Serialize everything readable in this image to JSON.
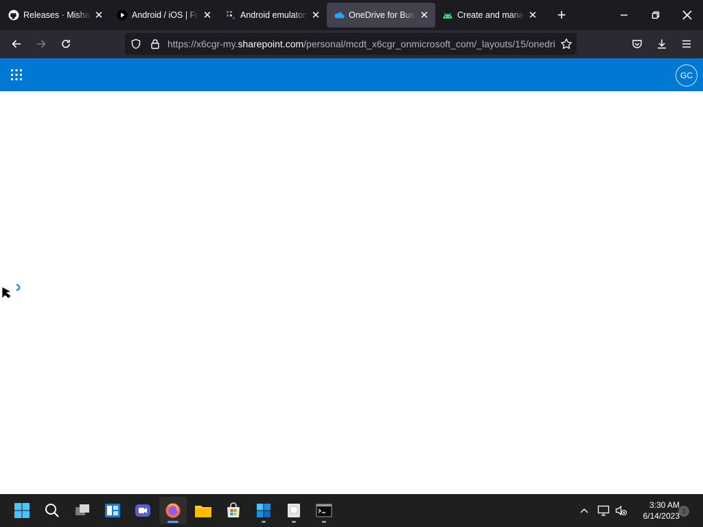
{
  "browser": {
    "tabs": [
      {
        "title": "Releases · MishaPro",
        "icon": "github-icon",
        "active": false
      },
      {
        "title": "Android / iOS | Free",
        "icon": "play-icon",
        "active": false
      },
      {
        "title": "Android emulators",
        "icon": "app-logo-icon",
        "active": false
      },
      {
        "title": "OneDrive for Busine",
        "icon": "onedrive-cloud-icon",
        "active": true
      },
      {
        "title": "Create and manage",
        "icon": "android-icon",
        "active": false
      }
    ],
    "url": {
      "prefix": "https://x6cgr-my.",
      "domain": "sharepoint.com",
      "path": "/personal/mcdt_x6cgr_onmicrosoft_com/_layouts/15/onedri"
    }
  },
  "page": {
    "suite_color": "#0078d4",
    "avatar_initials": "GC"
  },
  "taskbar": {
    "time": "3:30 AM",
    "date": "6/14/2023",
    "notification_count": "3"
  },
  "colors": {
    "tabstrip": "#1c1b22",
    "navbar": "#2b2a33",
    "accent": "#0078d4"
  }
}
